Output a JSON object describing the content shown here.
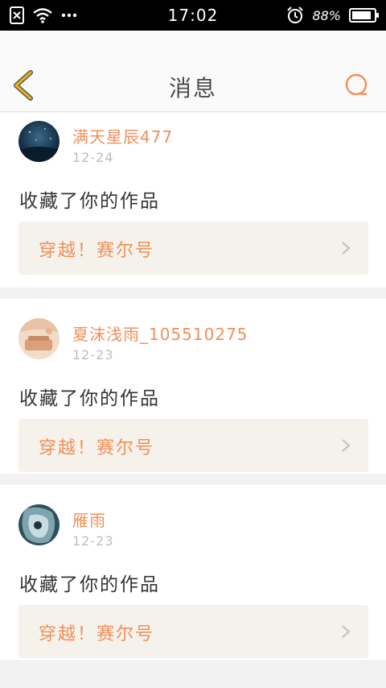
{
  "status_bar": {
    "time": "17:02",
    "battery_percent": "88%",
    "battery_level": 0.88
  },
  "header": {
    "title": "消息"
  },
  "colors": {
    "accent": "#f1905a",
    "back_arrow": "#e8b12c",
    "card_link_bg": "#f4f2ea"
  },
  "messages": [
    {
      "username": "满天星辰477",
      "date": "12-24",
      "action": "收藏了你的作品",
      "work_title": "穿越！赛尔号"
    },
    {
      "username": "夏沫浅雨_105510275",
      "date": "12-23",
      "action": "收藏了你的作品",
      "work_title": "穿越！赛尔号"
    },
    {
      "username": "雁雨",
      "date": "12-23",
      "action": "收藏了你的作品",
      "work_title": "穿越！赛尔号"
    }
  ]
}
